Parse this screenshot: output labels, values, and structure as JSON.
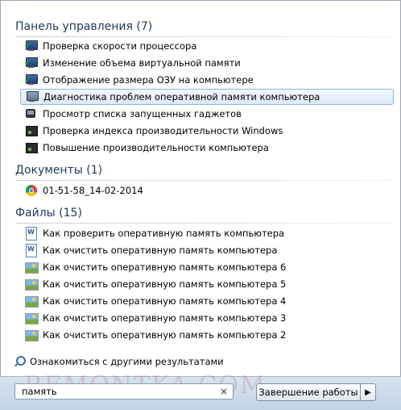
{
  "groups": [
    {
      "title": "Панель управления (7)",
      "items": [
        {
          "label": "Проверка скорости процессора",
          "icon": "system-monitor-icon"
        },
        {
          "label": "Изменение объема виртуальной памяти",
          "icon": "system-monitor-icon"
        },
        {
          "label": "Отображение размера ОЗУ на компьютере",
          "icon": "system-monitor-icon"
        },
        {
          "label": "Диагностика проблем оперативной памяти компьютера",
          "icon": "memory-diagnostic-icon"
        },
        {
          "label": "Просмотр списка запущенных гаджетов",
          "icon": "gadgets-icon"
        },
        {
          "label": "Проверка индекса производительности Windows",
          "icon": "performance-icon"
        },
        {
          "label": "Повышение производительности компьютера",
          "icon": "performance-icon"
        }
      ]
    },
    {
      "title": "Документы (1)",
      "items": [
        {
          "label": "01-51-58_14-02-2014",
          "icon": "chrome-icon"
        }
      ]
    },
    {
      "title": "Файлы (15)",
      "items": [
        {
          "label": "Как проверить оперативную память компьютера",
          "icon": "word-document-icon"
        },
        {
          "label": "Как очистить оперативную память компьютера",
          "icon": "word-document-icon"
        },
        {
          "label": "Как очистить оперативную память компьютера 6",
          "icon": "image-file-icon"
        },
        {
          "label": "Как очистить оперативную память компьютера 5",
          "icon": "image-file-icon"
        },
        {
          "label": "Как очистить оперативную память компьютера 4",
          "icon": "image-file-icon"
        },
        {
          "label": "Как очистить оперативную память компьютера 3",
          "icon": "image-file-icon"
        },
        {
          "label": "Как очистить оперативную память компьютера 2",
          "icon": "image-file-icon"
        }
      ]
    }
  ],
  "more_results": "Ознакомиться с другими результатами",
  "search": {
    "value": "память",
    "clear": "×"
  },
  "shutdown": {
    "label": "Завершение работы",
    "arrow": "▶"
  },
  "watermark": "REMONTKA.COM",
  "colors": {
    "header_text": "#1e395b",
    "selection_border": "#8db2e3",
    "bottom_bar": "#c2d3e6"
  }
}
